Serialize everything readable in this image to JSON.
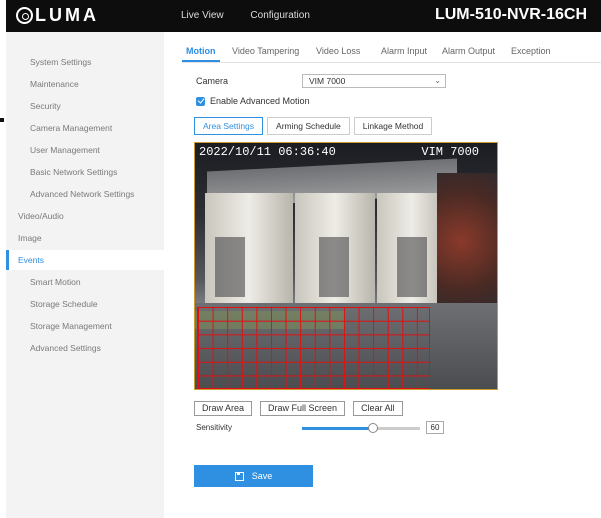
{
  "app": {
    "logo_text": "LUMA",
    "device_title": "LUM-510-NVR-16CH",
    "top_nav": [
      "Live View",
      "Configuration"
    ]
  },
  "sidebar": {
    "items": [
      {
        "label": "System Settings",
        "active": false
      },
      {
        "label": "Maintenance",
        "active": false
      },
      {
        "label": "Security",
        "active": false
      },
      {
        "label": "Camera Management",
        "active": false
      },
      {
        "label": "User Management",
        "active": false
      },
      {
        "label": "Basic Network Settings",
        "active": false
      },
      {
        "label": "Advanced Network Settings",
        "active": false
      },
      {
        "label": "Video/Audio",
        "active": false
      },
      {
        "label": "Image",
        "active": false
      },
      {
        "label": "Events",
        "active": true
      },
      {
        "label": "Smart Motion",
        "active": false
      },
      {
        "label": "Storage Schedule",
        "active": false
      },
      {
        "label": "Storage Management",
        "active": false
      },
      {
        "label": "Advanced Settings",
        "active": false
      }
    ]
  },
  "tabs": [
    {
      "label": "Motion",
      "active": true
    },
    {
      "label": "Video Tampering",
      "active": false
    },
    {
      "label": "Video Loss",
      "active": false
    },
    {
      "label": "Alarm Input",
      "active": false
    },
    {
      "label": "Alarm Output",
      "active": false
    },
    {
      "label": "Exception",
      "active": false
    }
  ],
  "form": {
    "camera_label": "Camera",
    "camera_value": "VIM 7000",
    "enable_label": "Enable Advanced Motion",
    "enable_checked": true
  },
  "subtabs": [
    {
      "label": "Area Settings",
      "active": true
    },
    {
      "label": "Arming Schedule",
      "active": false
    },
    {
      "label": "Linkage Method",
      "active": false
    }
  ],
  "video": {
    "timestamp": "2022/10/11 06:36:40",
    "camera_name": "VIM 7000"
  },
  "buttons": {
    "draw_area": "Draw Area",
    "draw_full_screen": "Draw Full Screen",
    "clear_all": "Clear All",
    "save": "Save"
  },
  "sensitivity": {
    "label": "Sensitivity",
    "value": "60",
    "fraction": 0.6
  },
  "colors": {
    "accent": "#2f8fe0",
    "motion_grid": "#e01010",
    "topbar": "#0d0d0d"
  }
}
